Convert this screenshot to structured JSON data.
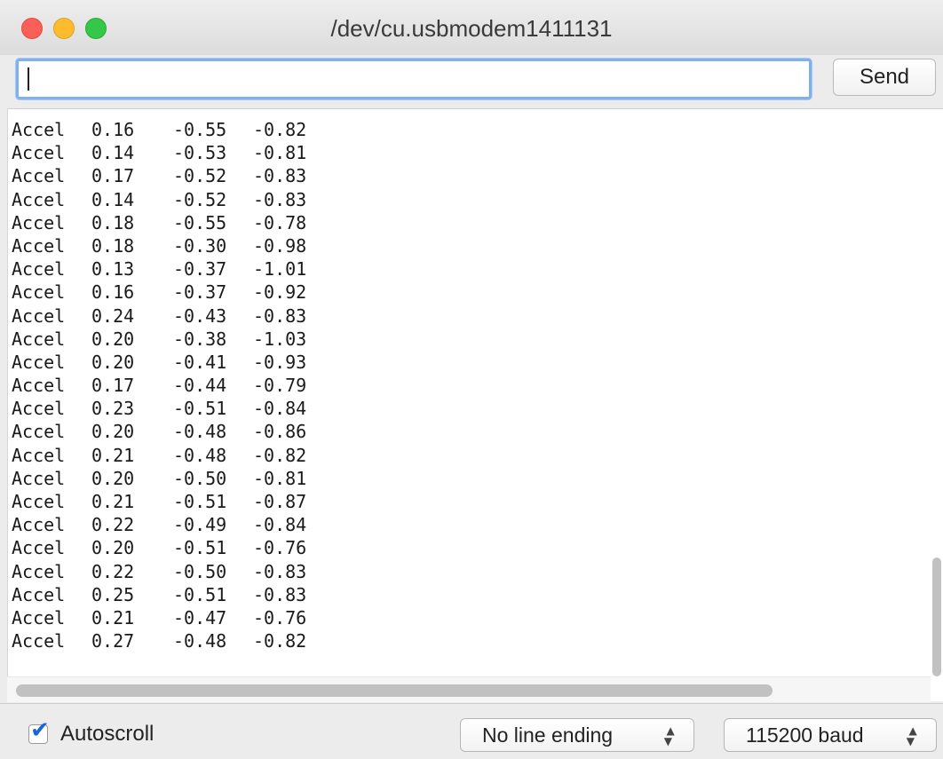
{
  "window": {
    "title": "/dev/cu.usbmodem1411131"
  },
  "input_row": {
    "input_value": "",
    "send_label": "Send"
  },
  "output": {
    "lines": [
      [
        "Accel",
        "0.16",
        "-0.55",
        "-0.82"
      ],
      [
        "Accel",
        "0.14",
        "-0.53",
        "-0.81"
      ],
      [
        "Accel",
        "0.17",
        "-0.52",
        "-0.83"
      ],
      [
        "Accel",
        "0.14",
        "-0.52",
        "-0.83"
      ],
      [
        "Accel",
        "0.18",
        "-0.55",
        "-0.78"
      ],
      [
        "Accel",
        "0.18",
        "-0.30",
        "-0.98"
      ],
      [
        "Accel",
        "0.13",
        "-0.37",
        "-1.01"
      ],
      [
        "Accel",
        "0.16",
        "-0.37",
        "-0.92"
      ],
      [
        "Accel",
        "0.24",
        "-0.43",
        "-0.83"
      ],
      [
        "Accel",
        "0.20",
        "-0.38",
        "-1.03"
      ],
      [
        "Accel",
        "0.20",
        "-0.41",
        "-0.93"
      ],
      [
        "Accel",
        "0.17",
        "-0.44",
        "-0.79"
      ],
      [
        "Accel",
        "0.23",
        "-0.51",
        "-0.84"
      ],
      [
        "Accel",
        "0.20",
        "-0.48",
        "-0.86"
      ],
      [
        "Accel",
        "0.21",
        "-0.48",
        "-0.82"
      ],
      [
        "Accel",
        "0.20",
        "-0.50",
        "-0.81"
      ],
      [
        "Accel",
        "0.21",
        "-0.51",
        "-0.87"
      ],
      [
        "Accel",
        "0.22",
        "-0.49",
        "-0.84"
      ],
      [
        "Accel",
        "0.20",
        "-0.51",
        "-0.76"
      ],
      [
        "Accel",
        "0.22",
        "-0.50",
        "-0.83"
      ],
      [
        "Accel",
        "0.25",
        "-0.51",
        "-0.83"
      ],
      [
        "Accel",
        "0.21",
        "-0.47",
        "-0.76"
      ],
      [
        "Accel",
        "0.27",
        "-0.48",
        "-0.82"
      ]
    ]
  },
  "bottom_bar": {
    "autoscroll_label": "Autoscroll",
    "autoscroll_checked": true,
    "line_ending_selected": "No line ending",
    "baud_selected": "115200 baud"
  },
  "icons": {
    "close": "close-traffic-light-icon",
    "minimize": "minimize-traffic-light-icon",
    "maximize": "maximize-traffic-light-icon",
    "checkmark": "checkmark-icon",
    "select_arrows": "updown-chevron-icon"
  },
  "colors": {
    "close": "#fc5f57",
    "minimize": "#fdbc2e",
    "maximize": "#34c84a",
    "focus_ring": "#7fb1ee",
    "checkmark": "#1a66d6"
  }
}
